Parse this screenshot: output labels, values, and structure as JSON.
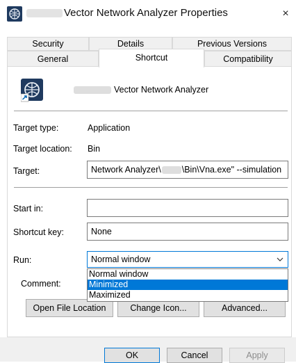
{
  "window": {
    "title": "Vector Network Analyzer Properties",
    "close_glyph": "×"
  },
  "tabs": {
    "row1": [
      {
        "label": "Security"
      },
      {
        "label": "Details"
      },
      {
        "label": "Previous Versions"
      }
    ],
    "row2": [
      {
        "label": "General"
      },
      {
        "label": "Shortcut"
      },
      {
        "label": "Compatibility"
      }
    ],
    "active": "Shortcut"
  },
  "shortcut": {
    "name": "Vector Network Analyzer",
    "target_type_label": "Target type:",
    "target_type_value": "Application",
    "target_location_label": "Target location:",
    "target_location_value": "Bin",
    "target_label": "Target:",
    "target_value_part1": "Network Analyzer\\",
    "target_value_part2": "\\Bin\\Vna.exe\" --simulation",
    "start_in_label": "Start in:",
    "start_in_value": "",
    "shortcut_key_label": "Shortcut key:",
    "shortcut_key_value": "None",
    "run_label": "Run:",
    "run_value": "Normal window",
    "run_options": [
      "Normal window",
      "Minimized",
      "Maximized"
    ],
    "run_highlighted": "Minimized",
    "comment_label": "Comment:"
  },
  "buttons": {
    "open_file_location": "Open File Location",
    "change_icon": "Change Icon...",
    "advanced": "Advanced...",
    "ok": "OK",
    "cancel": "Cancel",
    "apply": "Apply"
  }
}
